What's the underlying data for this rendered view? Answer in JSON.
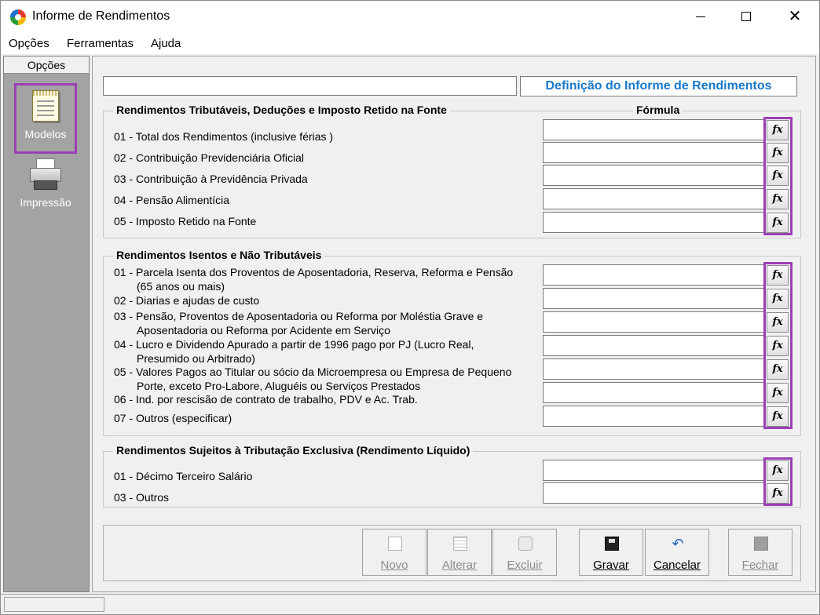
{
  "window": {
    "title": "Informe de Rendimentos"
  },
  "menu": {
    "opcoes": "Opções",
    "ferramentas": "Ferramentas",
    "ajuda": "Ajuda"
  },
  "sidebar": {
    "header": "Opções",
    "items": [
      {
        "label": "Modelos",
        "icon": "document-icon"
      },
      {
        "label": "Impressão",
        "icon": "printer-icon"
      }
    ]
  },
  "main": {
    "top_input_value": "",
    "definition_title": "Definição do Informe de Rendimentos",
    "formula_header": "Fórmula",
    "groups": [
      {
        "title": "Rendimentos Tributáveis, Deduções e Imposto Retido na Fonte",
        "rows": [
          {
            "label": "01 - Total dos Rendimentos (inclusive férias )",
            "formula": ""
          },
          {
            "label": "02 - Contribuição Previdenciária Oficial",
            "formula": ""
          },
          {
            "label": "03 - Contribuição à Previdência Privada",
            "formula": ""
          },
          {
            "label": "04 - Pensão Alimentícia",
            "formula": ""
          },
          {
            "label": "05 - Imposto Retido na Fonte",
            "formula": ""
          }
        ]
      },
      {
        "title": "Rendimentos Isentos e Não Tributáveis",
        "rows": [
          {
            "label": "01 - Parcela Isenta dos Proventos de Aposentadoria, Reserva, Reforma e Pensão",
            "label2": "(65 anos ou mais)",
            "formula": ""
          },
          {
            "label": "02 - Diarias e ajudas de custo",
            "formula": ""
          },
          {
            "label": "03 - Pensão, Proventos de Aposentadoria ou Reforma por Moléstia Grave e",
            "label2": "Aposentadoria ou Reforma por Acidente em Serviço",
            "formula": ""
          },
          {
            "label": "04 - Lucro e Dividendo Apurado a partir de 1996 pago por PJ (Lucro Real,",
            "label2": "Presumido ou Arbitrado)",
            "formula": ""
          },
          {
            "label": "05 - Valores Pagos ao Titular ou sócio da Microempresa ou Empresa de Pequeno",
            "label2": "Porte, exceto Pro-Labore, Aluguéis ou Serviços Prestados",
            "formula": ""
          },
          {
            "label": "06 - Ind. por rescisão de contrato de trabalho, PDV e Ac. Trab.",
            "formula": ""
          },
          {
            "label": "07 - Outros (especificar)",
            "formula": ""
          }
        ]
      },
      {
        "title": "Rendimentos Sujeitos à Tributação Exclusiva (Rendimento Líquido)",
        "rows": [
          {
            "label": "01 - Décimo Terceiro Salário",
            "formula": ""
          },
          {
            "label": "03 - Outros",
            "formula": ""
          }
        ]
      }
    ],
    "fx_label": "fx"
  },
  "toolbar": {
    "novo": "Novo",
    "alterar": "Alterar",
    "excluir": "Excluir",
    "gravar": "Gravar",
    "cancelar": "Cancelar",
    "fechar": "Fechar"
  },
  "colors": {
    "highlight": "#9b3fb5",
    "title_blue": "#1a78c9",
    "sidebar_bg": "#a3a3a3"
  }
}
